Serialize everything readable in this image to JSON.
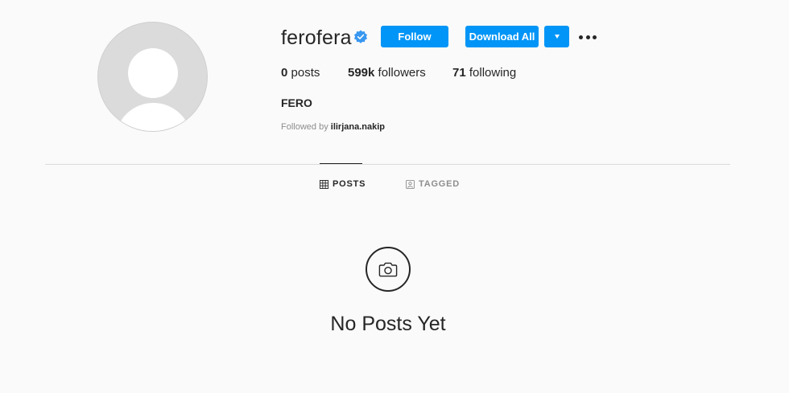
{
  "profile": {
    "username": "ferofera",
    "verified": true,
    "fullname": "FERO",
    "followed_by_prefix": "Followed by",
    "followed_by_user": "ilirjana.nakip",
    "stats": {
      "posts_count": "0",
      "posts_label": "posts",
      "followers_count": "599k",
      "followers_label": "followers",
      "following_count": "71",
      "following_label": "following"
    }
  },
  "actions": {
    "follow_label": "Follow",
    "download_all_label": "Download All",
    "dropdown_icon": "caret-down-icon",
    "more_icon": "more-options-icon"
  },
  "tabs": [
    {
      "label": "POSTS",
      "icon": "grid-icon",
      "active": true
    },
    {
      "label": "TAGGED",
      "icon": "tagged-user-icon",
      "active": false
    }
  ],
  "empty_state": {
    "icon": "camera-icon",
    "text": "No Posts Yet"
  },
  "colors": {
    "accent": "#0095f6",
    "background": "#fafafa",
    "text": "#262626",
    "muted": "#8e8e8e",
    "verified": "#3897f0"
  }
}
